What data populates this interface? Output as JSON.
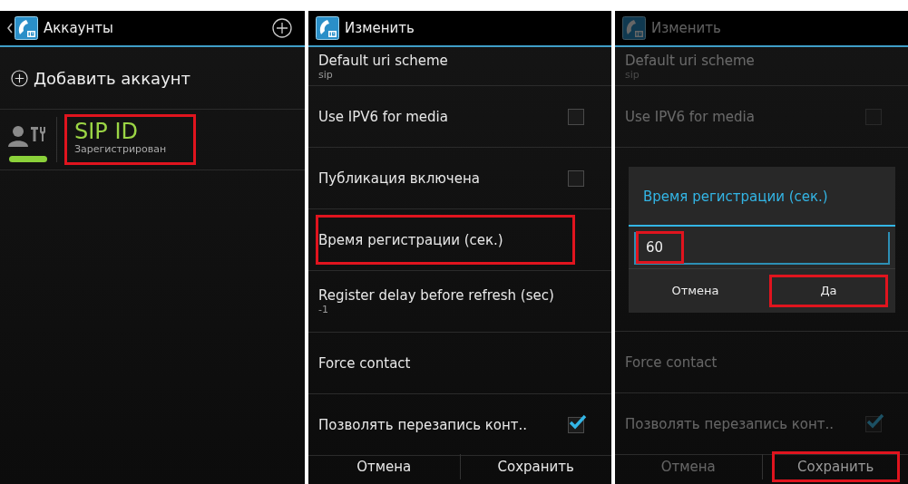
{
  "panels": [
    {
      "kind": "accounts",
      "title": "Аккаунты",
      "add_label": "Добавить аккаунт",
      "accounts": [
        {
          "name": "SIP ID",
          "status": "Зарегистрирован",
          "online": true,
          "highlighted": true
        }
      ]
    },
    {
      "kind": "settings",
      "title": "Изменить",
      "dimmed": false,
      "rows": [
        {
          "kind": "text",
          "title": "Default uri scheme",
          "summary": "sip",
          "highlighted": false
        },
        {
          "kind": "check",
          "title": "Use IPV6 for media",
          "checked": false,
          "highlighted": false
        },
        {
          "kind": "check",
          "title": "Публикация включена",
          "checked": false,
          "highlighted": false
        },
        {
          "kind": "text",
          "title": "Время регистрации (сек.)",
          "highlighted": true
        },
        {
          "kind": "text",
          "title": "Register delay before refresh (sec)",
          "summary": "-1",
          "highlighted": false
        },
        {
          "kind": "text",
          "title": "Force contact",
          "highlighted": false
        },
        {
          "kind": "check",
          "title": "Позволять перезапись конт..",
          "checked": true,
          "highlighted": false
        }
      ],
      "buttons": [
        {
          "label": "Отмена",
          "highlighted": false
        },
        {
          "label": "Сохранить",
          "highlighted": false
        }
      ]
    },
    {
      "kind": "settings",
      "title": "Изменить",
      "dimmed": true,
      "rows": [
        {
          "kind": "text",
          "title": "Default uri scheme",
          "summary": "sip",
          "highlighted": false
        },
        {
          "kind": "check",
          "title": "Use IPV6 for media",
          "checked": false,
          "highlighted": false
        },
        {
          "kind": "dialog",
          "title": "Время регистрации (сек.)",
          "value": "60",
          "value_highlighted": true,
          "buttons": [
            {
              "label": "Отмена",
              "highlighted": false
            },
            {
              "label": "Да",
              "highlighted": true
            }
          ]
        },
        {
          "kind": "text",
          "title": "Force contact",
          "highlighted": false
        },
        {
          "kind": "check",
          "title": "Позволять перезапись конт..",
          "checked": true,
          "highlighted": false
        }
      ],
      "buttons": [
        {
          "label": "Отмена",
          "highlighted": false
        },
        {
          "label": "Сохранить",
          "highlighted": true
        }
      ]
    }
  ]
}
